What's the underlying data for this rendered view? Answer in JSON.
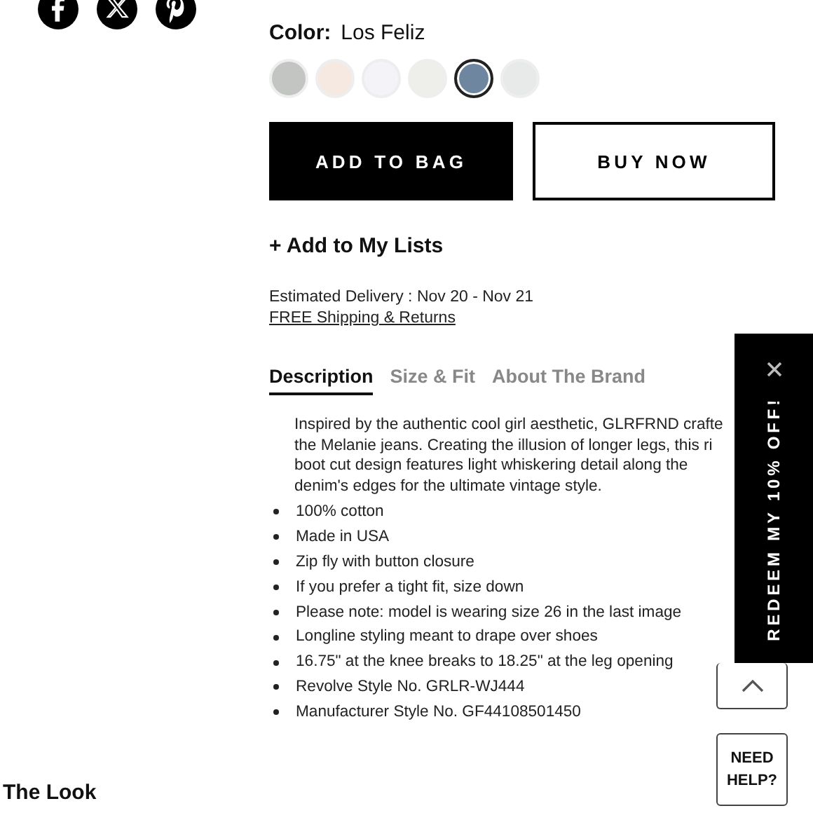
{
  "social_links": [
    {
      "kind": "facebook"
    },
    {
      "kind": "x"
    },
    {
      "kind": "pinterest"
    }
  ],
  "section_title": "The Look",
  "color": {
    "label": "Color:",
    "value": "Los Feliz",
    "swatches": [
      {
        "color": "#c3c5c2",
        "selected": false
      },
      {
        "color": "#f6e9e2",
        "selected": false
      },
      {
        "color": "#f4f4f8",
        "selected": false
      },
      {
        "color": "#eeefea",
        "selected": false
      },
      {
        "color": "#6f86a0",
        "selected": true
      },
      {
        "color": "#e8e9e9",
        "selected": false
      }
    ]
  },
  "buttons": [
    {
      "label": "ADD TO BAG",
      "kind": "primary"
    },
    {
      "label": "BUY NOW",
      "kind": "secondary"
    }
  ],
  "add_to_lists": "+ Add to My Lists",
  "delivery": "Estimated Delivery : Nov 20 - Nov 21",
  "shipping_link": "FREE Shipping & Returns",
  "tabs": [
    {
      "label": "Description",
      "selected": true
    },
    {
      "label": "Size & Fit",
      "selected": false
    },
    {
      "label": "About The Brand",
      "selected": false
    }
  ],
  "description_lines": [
    "Inspired by the authentic cool girl aesthetic, GLRFRND crafte",
    "the Melanie jeans. Creating the illusion of longer legs, this ri",
    "boot cut design features light whiskering detail along the",
    "denim's edges for the ultimate vintage style."
  ],
  "bullets": [
    "100% cotton",
    "Made in USA",
    "Zip fly with button closure",
    "If you prefer a tight fit, size down",
    "Please note: model is wearing size 26 in the last image",
    "Longline styling meant to drape over shoes",
    "16.75\" at the knee breaks to 18.25\" at the leg opening",
    "Revolve Style No. GRLR-WJ444",
    "Manufacturer Style No. GF44108501450"
  ],
  "promo": {
    "label": "REDEEM MY 10% OFF!"
  },
  "help_button": "NEED HELP?"
}
